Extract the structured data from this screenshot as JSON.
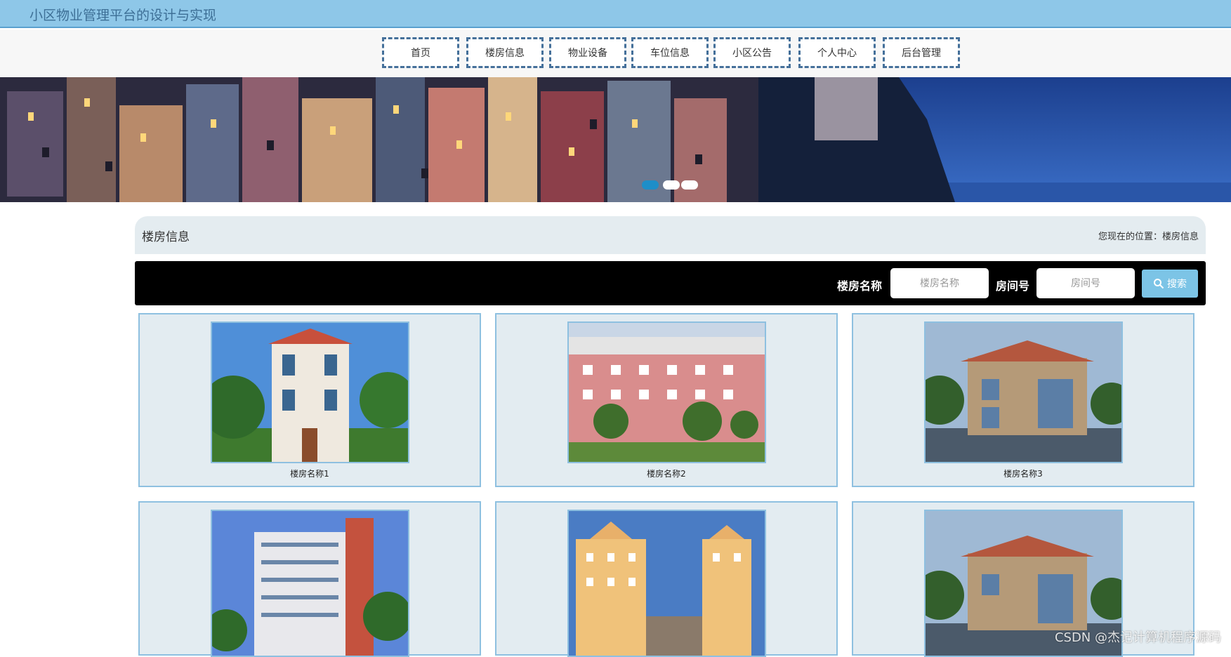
{
  "header": {
    "site_title": "小区物业管理平台的设计与实现"
  },
  "nav": {
    "items": [
      {
        "label": "首页"
      },
      {
        "label": "楼房信息"
      },
      {
        "label": "物业设备"
      },
      {
        "label": "车位信息"
      },
      {
        "label": "小区公告"
      },
      {
        "label": "个人中心"
      },
      {
        "label": "后台管理"
      }
    ]
  },
  "banner": {
    "active_slide": 1,
    "slide_count": 3
  },
  "section": {
    "title": "楼房信息",
    "breadcrumb": "您现在的位置：楼房信息"
  },
  "search": {
    "name_label": "楼房名称",
    "name_placeholder": "楼房名称",
    "room_label": "房间号",
    "room_placeholder": "房间号",
    "button_label": "搜索"
  },
  "buildings": [
    {
      "name": "楼房名称1"
    },
    {
      "name": "楼房名称2"
    },
    {
      "name": "楼房名称3"
    },
    {
      "name": ""
    },
    {
      "name": ""
    },
    {
      "name": ""
    }
  ],
  "watermark": "CSDN @杰记计算机程序源码",
  "colors": {
    "topbar": "#8ec7e8",
    "nav_border": "#45709a",
    "card_bg": "#e3ecf1",
    "card_border": "#8ec0e0",
    "search_button": "#7cc4e6"
  }
}
